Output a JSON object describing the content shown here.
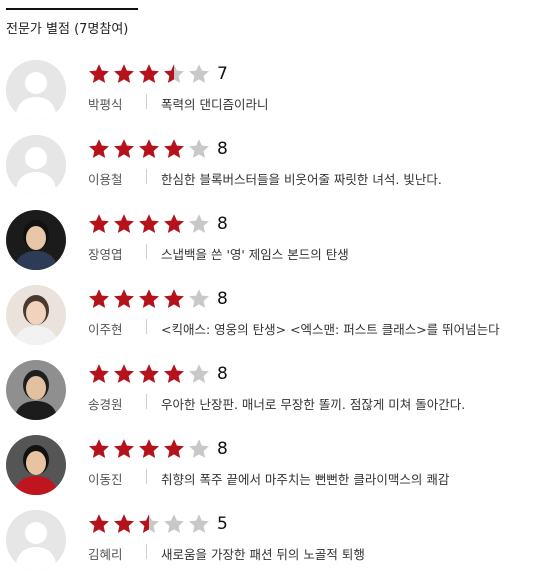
{
  "header": {
    "title": "전문가 별점 (7명참여)"
  },
  "colors": {
    "star_filled": "#b5121b",
    "star_empty": "#c8c8c8"
  },
  "reviews": [
    {
      "name": "박평식",
      "score": "7",
      "rating": 3.5,
      "comment": "폭력의 댄디즘이라니",
      "avatar": "placeholder-avatar"
    },
    {
      "name": "이용철",
      "score": "8",
      "rating": 4,
      "comment": "한심한 블록버스터들을 비웃어줄 짜릿한 녀석. 빛난다.",
      "avatar": "placeholder-avatar"
    },
    {
      "name": "장영엽",
      "score": "8",
      "rating": 4,
      "comment": "스냅백을 쓴 '영' 제임스 본드의 탄생",
      "avatar": "photo-avatar"
    },
    {
      "name": "이주현",
      "score": "8",
      "rating": 4,
      "comment": "<킥애스: 영웅의 탄생> <엑스맨: 퍼스트 클래스>를 뛰어넘는다",
      "avatar": "photo-avatar"
    },
    {
      "name": "송경원",
      "score": "8",
      "rating": 4,
      "comment": "우아한 난장판. 매너로 무장한 똘끼. 점잖게 미쳐 돌아간다.",
      "avatar": "photo-avatar"
    },
    {
      "name": "이동진",
      "score": "8",
      "rating": 4,
      "comment": "취향의 폭주 끝에서 마주치는 뻔뻔한 클라이맥스의 쾌감",
      "avatar": "photo-avatar"
    },
    {
      "name": "김혜리",
      "score": "5",
      "rating": 2.5,
      "comment": "새로움을 가장한 패션 뒤의 노골적 퇴행",
      "avatar": "placeholder-avatar"
    }
  ]
}
